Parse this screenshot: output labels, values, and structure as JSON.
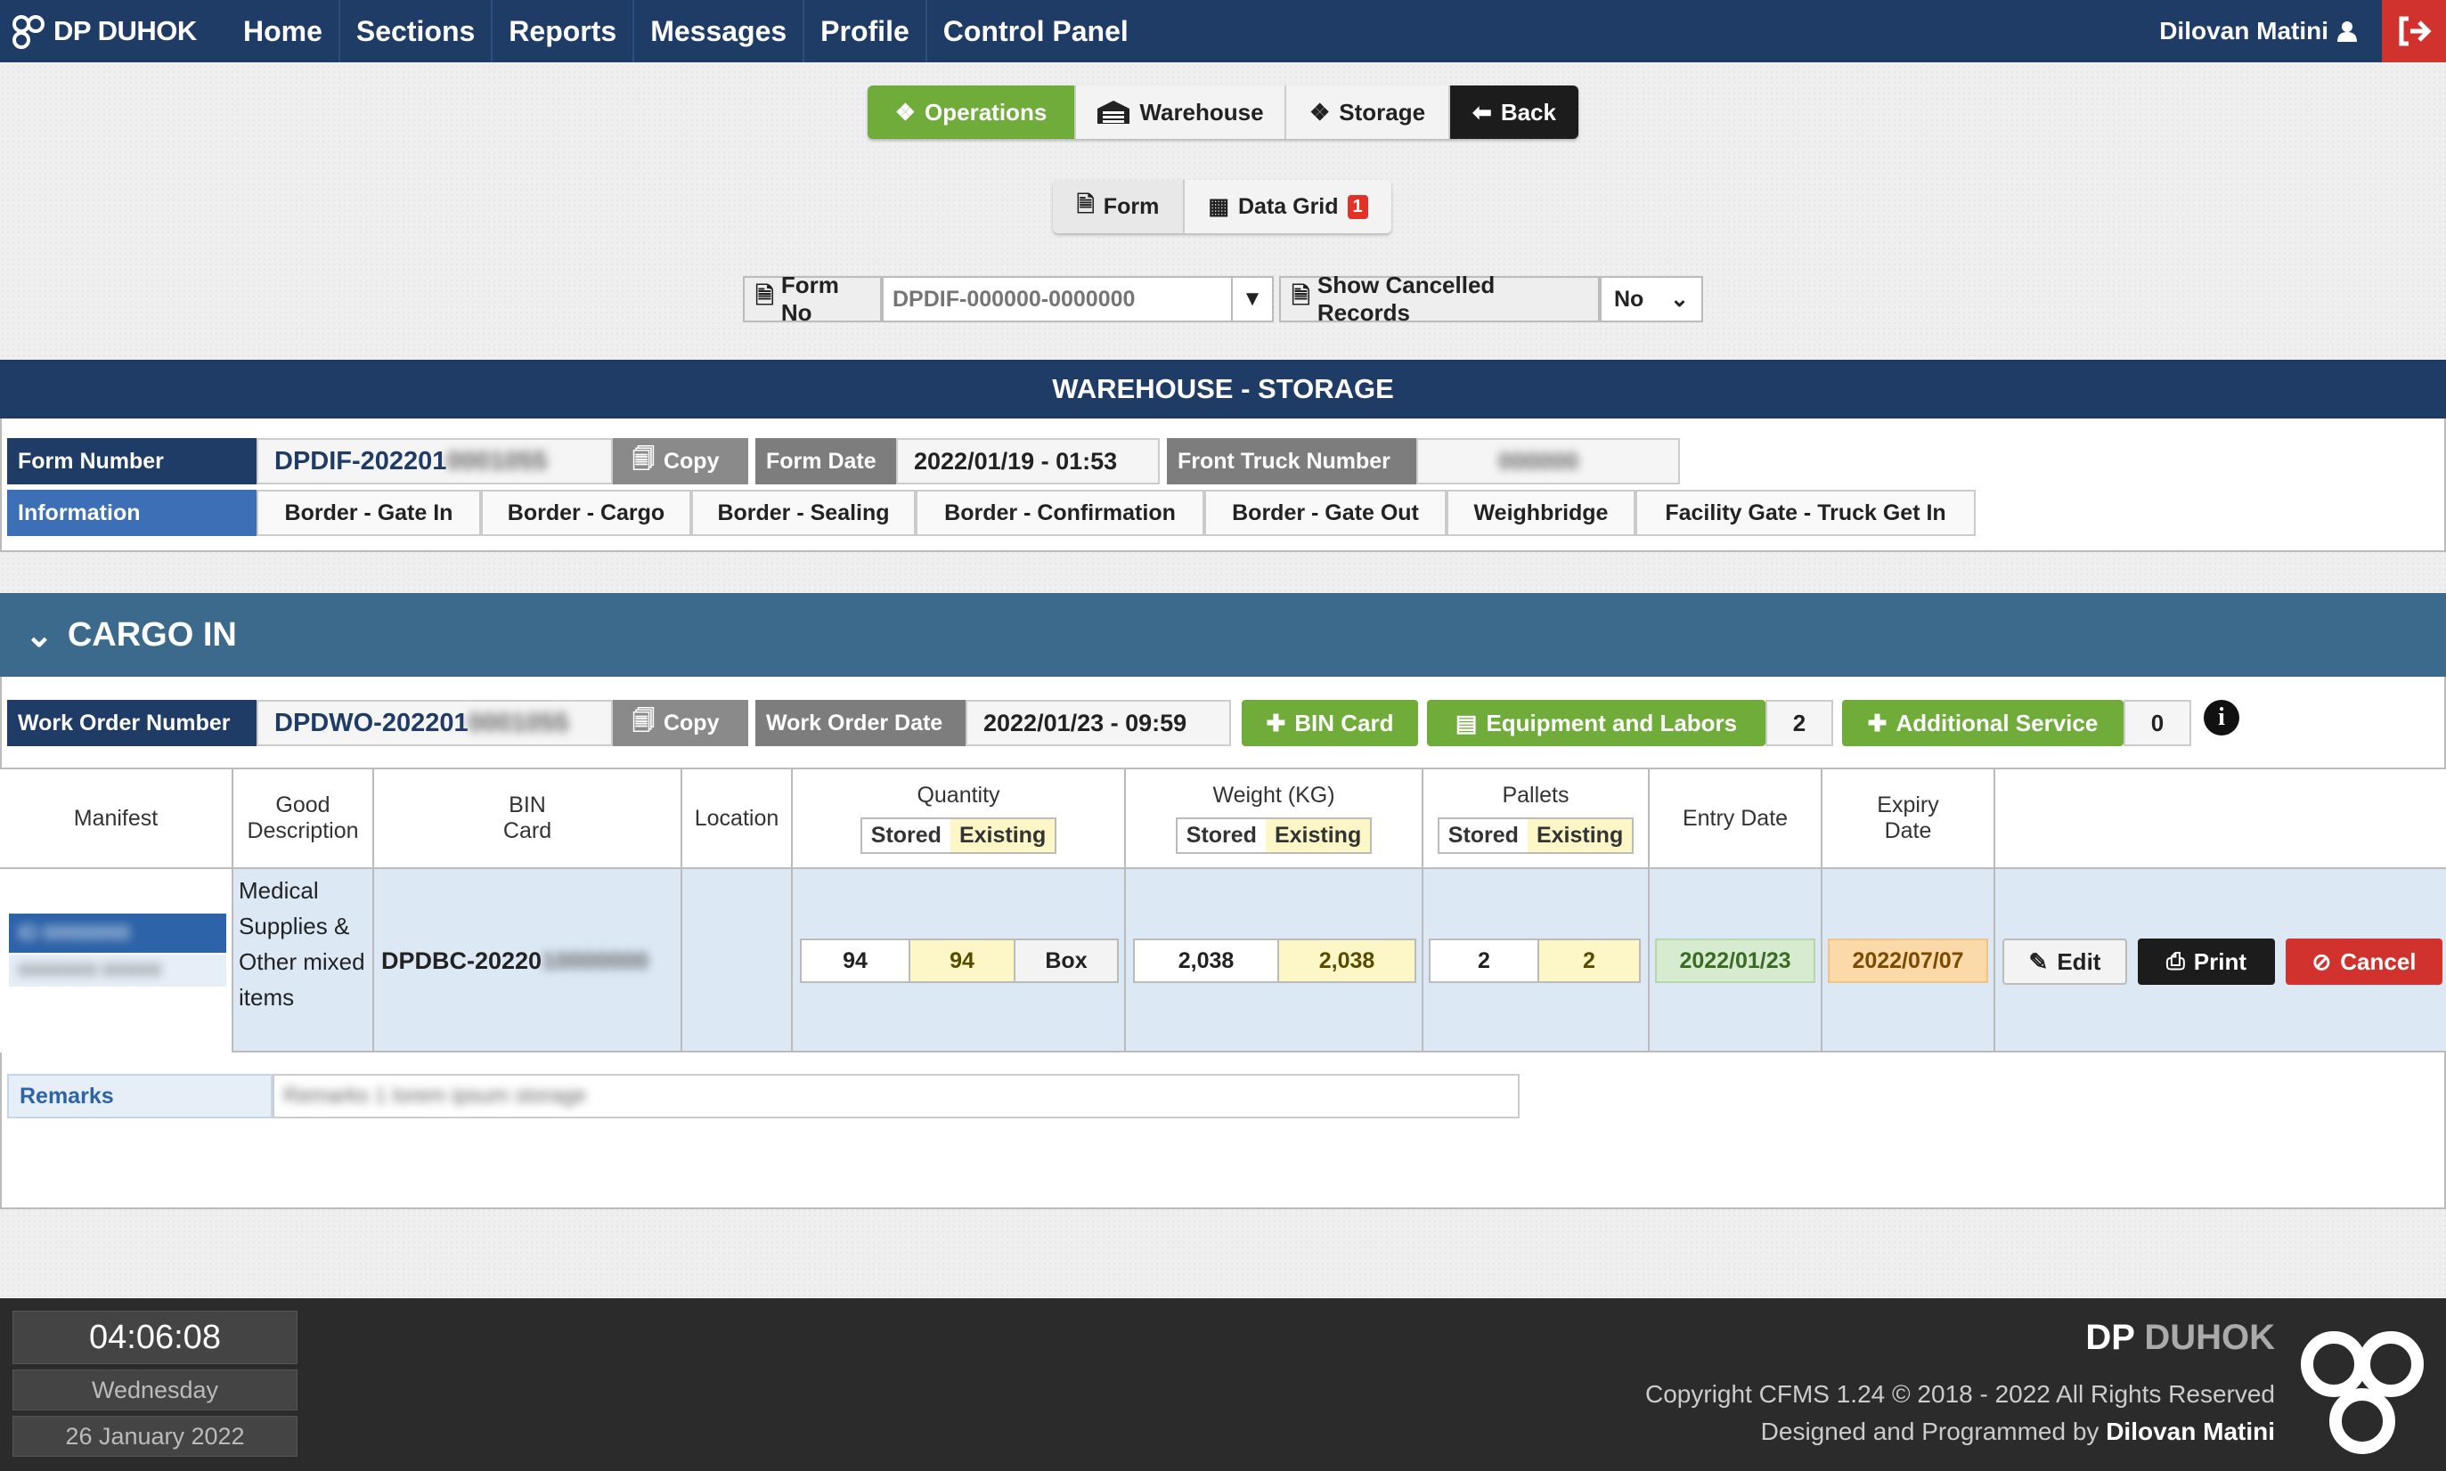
{
  "nav": {
    "brand": "DP DUHOK",
    "menu": [
      "Home",
      "Sections",
      "Reports",
      "Messages",
      "Profile",
      "Control Panel"
    ],
    "user": "Dilovan Matini"
  },
  "modules": {
    "operations": "Operations",
    "warehouse": "Warehouse",
    "storage": "Storage",
    "back": "Back"
  },
  "views": {
    "form": "Form",
    "data_grid": "Data Grid",
    "data_grid_badge": "1"
  },
  "search": {
    "form_no_label": "Form No",
    "form_no_placeholder": "DPDIF-000000-0000000",
    "show_cancelled_label": "Show Cancelled Records",
    "show_cancelled_value": "No"
  },
  "warehouse": {
    "title": "WAREHOUSE - STORAGE",
    "form_number_label": "Form Number",
    "form_number_value": "DPDIF-202201",
    "form_number_hidden": "0001055",
    "copy": "Copy",
    "form_date_label": "Form Date",
    "form_date_value": "2022/01/19 - 01:53",
    "front_truck_label": "Front Truck Number",
    "front_truck_value": "000000",
    "information_label": "Information",
    "info_tabs": [
      "Border - Gate In",
      "Border - Cargo",
      "Border - Sealing",
      "Border - Confirmation",
      "Border - Gate Out",
      "Weighbridge",
      "Facility Gate - Truck Get In"
    ]
  },
  "cargo": {
    "title": "CARGO IN",
    "work_order_label": "Work Order Number",
    "work_order_value": "DPDWO-202201",
    "work_order_hidden": "0001055",
    "copy": "Copy",
    "work_order_date_label": "Work Order Date",
    "work_order_date_value": "2022/01/23 - 09:59",
    "bin_card_button": "BIN Card",
    "equipment_button": "Equipment and Labors",
    "equipment_count": "2",
    "additional_button": "Additional Service",
    "additional_count": "0",
    "columns": {
      "manifest": "Manifest",
      "good_description": "Good Description",
      "bin_card": "BIN Card",
      "location": "Location",
      "quantity": "Quantity",
      "weight": "Weight (KG)",
      "pallets": "Pallets",
      "entry_date": "Entry Date",
      "expiry_date": "Expiry Date",
      "stored": "Stored",
      "existing": "Existing"
    },
    "row": {
      "manifest_hidden": "ID 00000000",
      "manifest_hidden2": "00000000 000000",
      "good_description": "Medical Supplies & Other mixed items",
      "bin_card": "DPDBC-20220",
      "bin_card_hidden": "10000000",
      "qty_stored": "94",
      "qty_existing": "94",
      "qty_unit": "Box",
      "weight_stored": "2,038",
      "weight_existing": "2,038",
      "pallets_stored": "2",
      "pallets_existing": "2",
      "entry_date": "2022/01/23",
      "expiry_date": "2022/07/07",
      "edit": "Edit",
      "print": "Print",
      "cancel": "Cancel"
    },
    "remarks_label": "Remarks",
    "remarks_hidden": "Remarks 1 lorem ipsum storage"
  },
  "footer": {
    "time": "04:06:08",
    "day": "Wednesday",
    "date": "26 January 2022",
    "brand_a": "DP",
    "brand_b": "DUHOK",
    "copyright": "Copyright CFMS 1.24 © 2018 - 2022 All Rights Reserved",
    "designed_prefix": "Designed and Programmed by",
    "designer": "Dilovan Matini"
  },
  "colors": {
    "navy": "#1e3c66",
    "green": "#6fac3a",
    "red": "#d2322d",
    "cargo": "#3c6a8c"
  }
}
